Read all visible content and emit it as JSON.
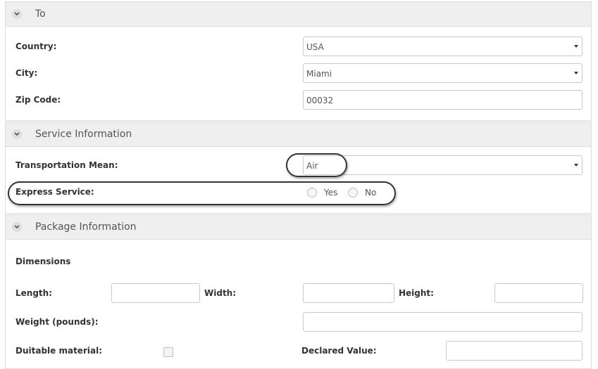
{
  "to_section": {
    "title": "To",
    "country_label": "Country:",
    "country_value": "USA",
    "city_label": "City:",
    "city_value": "Miami",
    "zip_label": "Zip Code:",
    "zip_value": "00032"
  },
  "service_section": {
    "title": "Service Information",
    "transport_label": "Transportation Mean:",
    "transport_value": "Air",
    "express_label": "Express Service:",
    "express_yes": "Yes",
    "express_no": "No"
  },
  "package_section": {
    "title": "Package Information",
    "dimensions_heading": "Dimensions",
    "length_label": "Length:",
    "width_label": "Width:",
    "height_label": "Height:",
    "weight_label": "Weight (pounds):",
    "duitable_label": "Duitable material:",
    "declared_label": "Declared Value:"
  },
  "icons": {
    "section_toggle": "chevron-down-icon",
    "select_caret": "caret-down-icon"
  },
  "colors": {
    "header_bg": "#efefef",
    "annotation": "#333333"
  }
}
